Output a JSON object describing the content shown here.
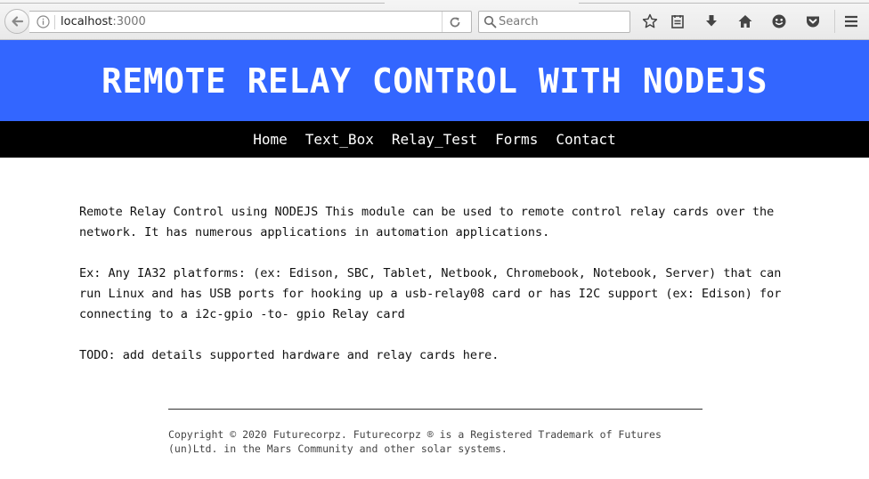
{
  "browser": {
    "url_host": "localhost",
    "url_port": ":3000",
    "search_placeholder": "Search",
    "icons": {
      "back": "back-arrow-icon",
      "info": "info-icon",
      "reload": "reload-icon",
      "search": "search-icon",
      "bookmark": "star-icon",
      "reader": "reading-list-icon",
      "downloads": "download-icon",
      "home": "home-icon",
      "face": "smiley-icon",
      "pocket": "pocket-icon",
      "menu": "hamburger-menu-icon"
    }
  },
  "site": {
    "title": "REMOTE RELAY CONTROL WITH NODEJS",
    "header_color": "#3366ff",
    "nav_color": "#000000",
    "nav": [
      {
        "label": "Home"
      },
      {
        "label": "Text_Box"
      },
      {
        "label": "Relay_Test"
      },
      {
        "label": "Forms"
      },
      {
        "label": "Contact"
      }
    ]
  },
  "content": {
    "paragraphs": [
      "Remote Relay Control using NODEJS This module can be used to remote control relay cards over the network. It has numerous applications in automation applications.",
      "Ex: Any IA32 platforms: (ex: Edison, SBC, Tablet, Netbook, Chromebook, Notebook, Server) that can run Linux and has USB ports for hooking up a usb-relay08 card or has I2C support (ex: Edison) for connecting to a i2c-gpio -to- gpio Relay card",
      "TODO: add details supported hardware and relay cards here."
    ]
  },
  "footer": {
    "text": "Copyright © 2020 Futurecorpz. Futurecorpz ® is a Registered Trademark of Futures (un)Ltd. in the Mars Community and other solar systems."
  }
}
